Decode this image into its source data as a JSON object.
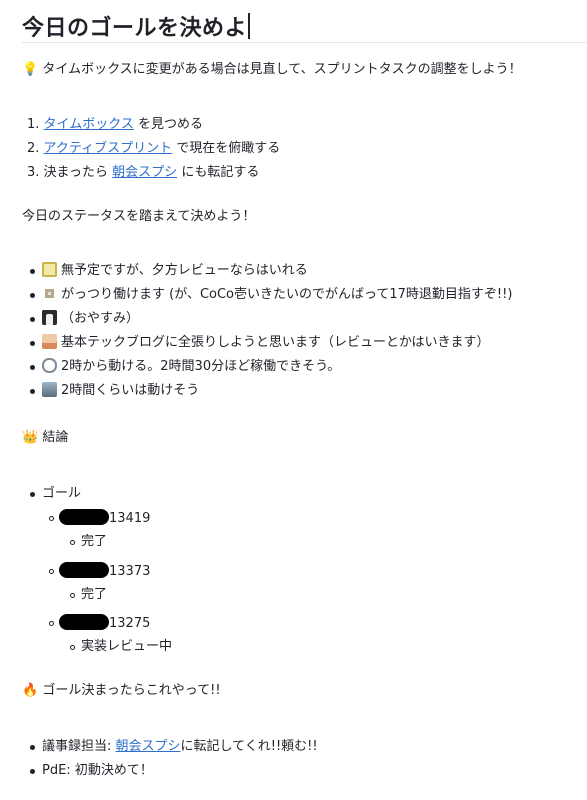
{
  "title": "今日のゴールを決めよ",
  "tip": {
    "text": "タイムボックスに変更がある場合は見直して、スプリントタスクの調整をしよう！"
  },
  "steps": [
    {
      "num": "1.",
      "link": "タイムボックス",
      "rest": " を見つめる"
    },
    {
      "num": "2.",
      "link": "アクティブスプリント",
      "rest": " で現在を俯瞰する"
    },
    {
      "num": "3.",
      "pre": "決まったら ",
      "link": "朝会スプシ",
      "rest": " にも転記する"
    }
  ],
  "status_heading": "今日のステータスを踏まえて決めよう！",
  "statuses": [
    {
      "icon": "calendar-avatar-icon",
      "text": "無予定ですが、夕方レビューならはいれる"
    },
    {
      "icon": "statue-avatar-icon",
      "text": "がっつり働けます (が、CoCo壱いきたいのでがんばって17時退勤目指すぞ!!)"
    },
    {
      "icon": "panda-avatar-icon",
      "text": "（おやすみ）"
    },
    {
      "icon": "photo-avatar-icon",
      "text": "基本テックブログに全張りしようと思います（レビューとかはいきます）"
    },
    {
      "icon": "cloud-emoji-icon",
      "text": "2時から動ける。2時間30分ほど稼働できそう。"
    },
    {
      "icon": "landscape-avatar-icon",
      "text": "2時間くらいは動けそう"
    }
  ],
  "conclusion": {
    "emoji": "👑",
    "heading": "結論"
  },
  "goal_label": "ゴール",
  "goals": [
    {
      "id": "13419",
      "status": "完了"
    },
    {
      "id": "13373",
      "status": "完了"
    },
    {
      "id": "13275",
      "status": "実装レビュー中"
    }
  ],
  "after": {
    "emoji": "🔥",
    "heading": "ゴール決まったらこれやって!!"
  },
  "todo": [
    {
      "pre": "議事録担当: ",
      "link": "朝会スプシ",
      "rest": "に転記してくれ!!頼む!!"
    },
    {
      "pre": "PdE: 初動決めて！"
    }
  ],
  "colors": {
    "link": "#2f6fcb",
    "text": "#1f2329"
  }
}
